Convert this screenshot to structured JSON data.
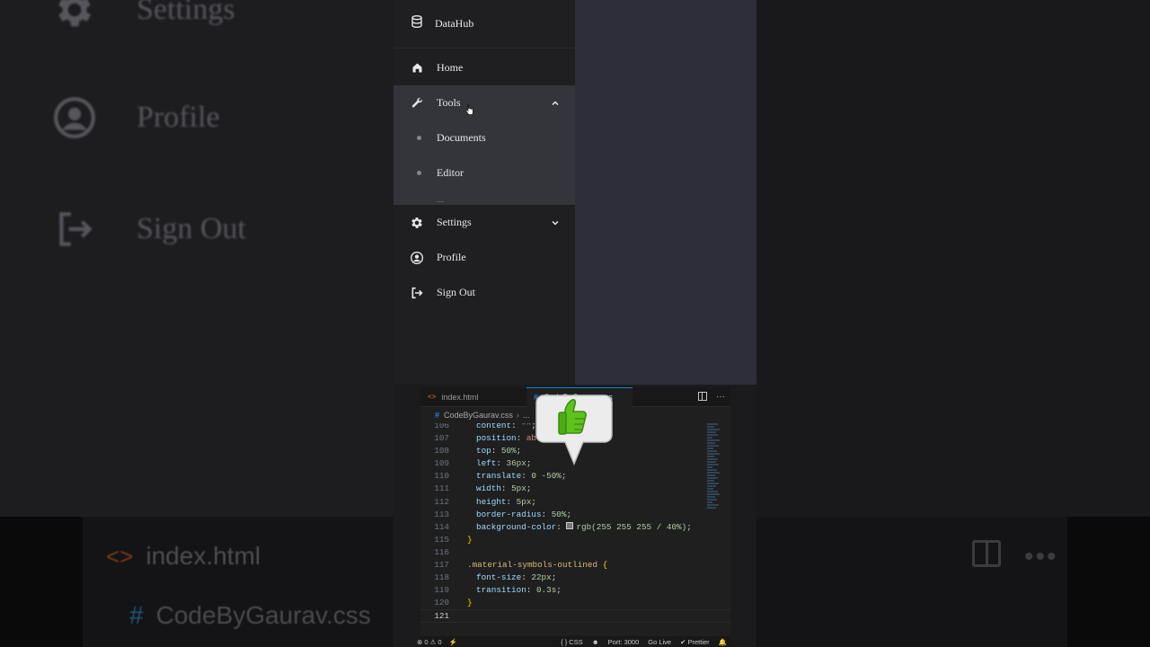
{
  "background": {
    "items": [
      {
        "label": "Settings",
        "icon": "gear-icon"
      },
      {
        "label": "Profile",
        "icon": "account-circle-icon"
      },
      {
        "label": "Sign Out",
        "icon": "logout-icon"
      }
    ],
    "editor_tab": "index.html",
    "editor_file": "CodeByGaurav.css",
    "ghost_code": "186       content:"
  },
  "preview": {
    "brand": {
      "name": "DataHub",
      "icon": "database-icon"
    },
    "nav": [
      {
        "label": "Home",
        "icon": "home-icon"
      },
      {
        "label": "Tools",
        "icon": "wrench-icon",
        "expanded": true
      },
      {
        "label": "Settings",
        "icon": "gear-icon",
        "expanded": false
      },
      {
        "label": "Profile",
        "icon": "account-circle-icon"
      },
      {
        "label": "Sign Out",
        "icon": "logout-icon"
      }
    ],
    "submenu": [
      {
        "label": "Documents"
      },
      {
        "label": "Editor"
      }
    ],
    "colors": {
      "sidebar": "#1f1f22",
      "active": "#34343b",
      "content": "#2e2e3a"
    }
  },
  "editor": {
    "tabs": [
      {
        "label": "index.html",
        "icon": "html-tag-icon"
      },
      {
        "label": "CodeByGaurav.css",
        "icon": "css-hash-icon"
      }
    ],
    "breadcrumb": {
      "file": "CodeByGaurav.css",
      "more": "..."
    },
    "lines": [
      {
        "n": "106"
      },
      {
        "n": "107"
      },
      {
        "n": "108"
      },
      {
        "n": "109"
      },
      {
        "n": "110"
      },
      {
        "n": "111"
      },
      {
        "n": "112"
      },
      {
        "n": "113"
      },
      {
        "n": "114"
      },
      {
        "n": "115"
      },
      {
        "n": "116"
      },
      {
        "n": "117"
      },
      {
        "n": "118"
      },
      {
        "n": "119"
      },
      {
        "n": "120"
      },
      {
        "n": "121"
      }
    ],
    "code": {
      "l106_prop": "content",
      "l106_val": "\"\"",
      "l107_prop": "position",
      "l107_val": "absolute",
      "l108_prop": "top",
      "l108_val": "50%",
      "l109_prop": "left",
      "l109_val": "36px",
      "l110_prop": "translate",
      "l110_val": "0 -50%",
      "l111_prop": "width",
      "l111_val": "5px",
      "l112_prop": "height",
      "l112_val": "5px",
      "l113_prop": "border-radius",
      "l113_val": "50%",
      "l114_prop": "background-color",
      "l114_val": "rgb(255 255 255 / 40%)",
      "l115": "}",
      "l117_sel": ".material-symbols-outlined",
      "l117_brace": "{",
      "l118_prop": "font-size",
      "l118_val": "22px",
      "l119_prop": "transition",
      "l119_val": "0.3s",
      "l120": "}"
    },
    "status": {
      "problems": "⊗ 0 ⚠ 0",
      "lang": "{ } CSS",
      "port": "Port: 3000",
      "golive": "Go Live",
      "prettier": "✔ Prettier"
    }
  },
  "sticker": {
    "icon": "thumbs-up-icon",
    "color": "#5ec21e"
  }
}
